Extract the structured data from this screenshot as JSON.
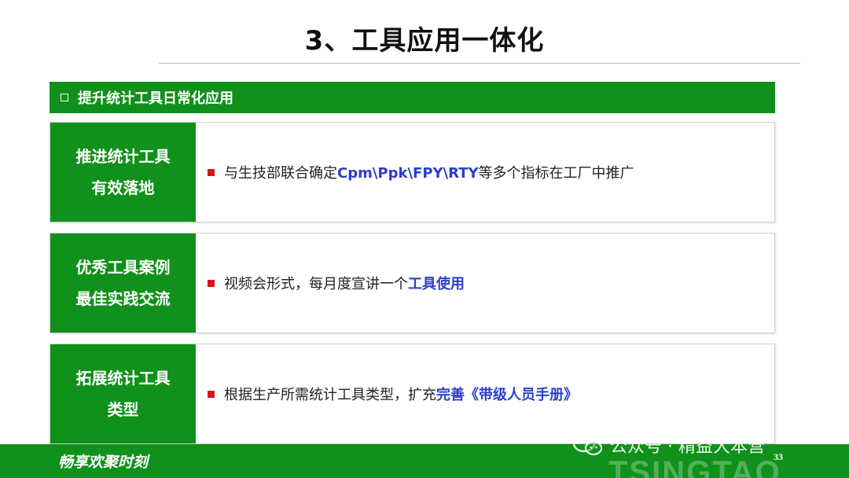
{
  "slide": {
    "title": "3、工具应用一体化",
    "section_header": "提升统计工具日常化应用",
    "rows": [
      {
        "label_lines": [
          "推进统计工具",
          "有效落地"
        ],
        "content": {
          "prefix": "与生技部联合确定",
          "highlight": "Cpm\\Ppk\\FPY\\RTY",
          "suffix": "等多个指标在工厂中推广"
        }
      },
      {
        "label_lines": [
          "优秀工具案例",
          "最佳实践交流"
        ],
        "content": {
          "prefix": "视频会形式，每月度宣讲一个",
          "highlight": "工具使用",
          "suffix": ""
        }
      },
      {
        "label_lines": [
          "拓展统计工具",
          "类型"
        ],
        "content": {
          "prefix": "根据生产所需统计工具类型，扩充",
          "highlight": "完善《带级人员手册》",
          "suffix": ""
        }
      }
    ]
  },
  "footer": {
    "slogan": "畅享欢聚时刻",
    "page_number": "33",
    "brand": "TSINGTAO"
  },
  "watermark": {
    "text": "公众号 · 精益大本营",
    "icon": "wechat-icon"
  },
  "colors": {
    "primary_green": "#10911b",
    "highlight_blue": "#2b3fc8",
    "bullet_red": "#d9141c"
  }
}
